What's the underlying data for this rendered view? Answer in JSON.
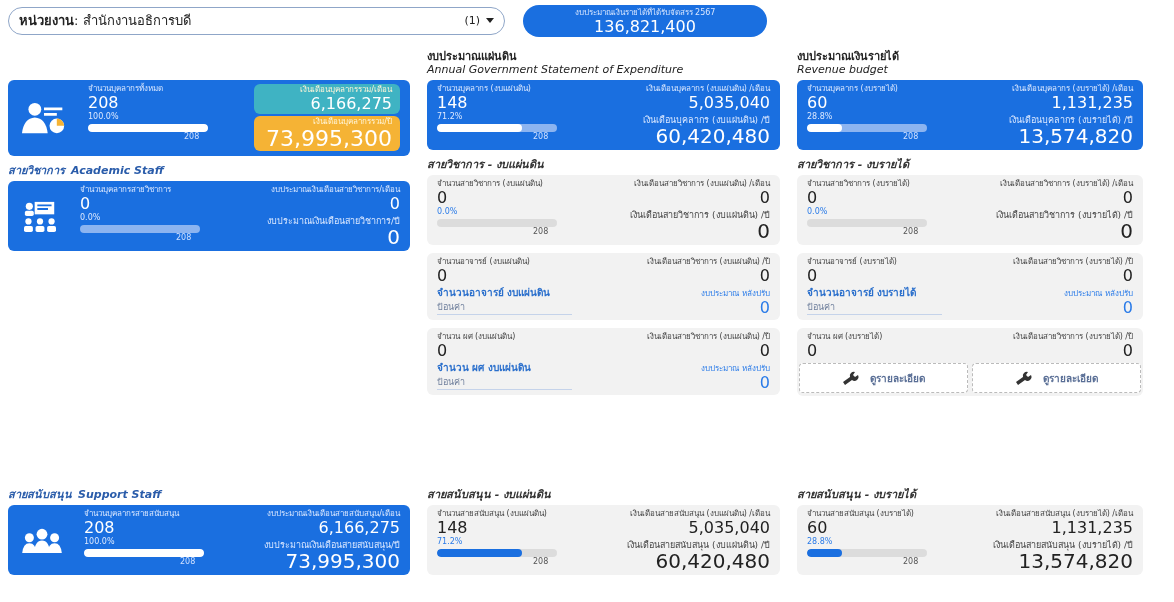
{
  "header": {
    "unit": "**หน่วยงาน**: สำนักงานอธิการบดี",
    "count_badge": "(1)",
    "budget": {
      "label": "งบประมาณเงินรายได้ที่ได้รับจัดสรร 2567",
      "value": "136,821,400"
    }
  },
  "summary": {
    "card": {
      "count_label": "จำนวนบุคลากรทั้งหมด",
      "count": "208",
      "percent": "100.0%",
      "level": 1,
      "scale": "208",
      "amounts": [
        {
          "color": "#3fb3c3",
          "label": "เงินเดือนบุคลากรรวม/เดือน",
          "value": "6,166,275"
        },
        {
          "color": "#f5b335",
          "label": "เงินเดือนบุคลากรรวม/ปี",
          "value": "73,995,300"
        }
      ]
    }
  },
  "budgets": [
    {
      "title": "งบประมาณแผ่นดิน",
      "subtitle": "Annual Government Statement of Expenditure",
      "card": {
        "count_label": "จำนวนบุคลากร (งบแผ่นดิน)",
        "count": "148",
        "percent": "71.2%",
        "level": 0.712,
        "scale": "208",
        "amounts": [
          {
            "label": "เงินเดือนบุคลากร (งบแผ่นดิน) /เดือน",
            "value": "5,035,040"
          },
          {
            "label": "เงินเดือนบุคลากร (งบแผ่นดิน) /ปี",
            "value": "60,420,480"
          }
        ]
      }
    },
    {
      "title": "งบประมาณเงินรายได้",
      "subtitle": "Revenue budget",
      "card": {
        "count_label": "จำนวนบุคลากร (งบรายได้)",
        "count": "60",
        "percent": "28.8%",
        "level": 0.288,
        "scale": "208",
        "amounts": [
          {
            "label": "เงินเดือนบุคลากร (งบรายได้) /เดือน",
            "value": "1,131,235"
          },
          {
            "label": "เงินเดือนบุคลากร (งบรายได้) /ปี",
            "value": "13,574,820"
          }
        ]
      }
    }
  ],
  "academic": {
    "title": "สายวิชาการ",
    "title_en": "Academic Staff",
    "card": {
      "count_label": "จำนวนบุคลากรสายวิชาการ",
      "count": "0",
      "percent": "0.0%",
      "scale": "208",
      "amounts": [
        {
          "label": "งบประมาณเงินเดือนสายวิชาการ/เดือน",
          "value": "0"
        },
        {
          "label": "งบประมาณเงินเดือนสายวิชาการ/ปี",
          "value": "0"
        }
      ]
    }
  },
  "academic_budgets": [
    {
      "title": "สายวิชาการ - งบแผ่นดิน",
      "cards": [
        {
          "count_label": "จำนวนสายวิชาการ (งบแผ่นดิน)",
          "count": "0",
          "percent": "0.0%",
          "scale": "208",
          "amounts": [
            {
              "label": "เงินเดือนสายวิชาการ (งบแผ่นดิน) /เดือน",
              "value": "0"
            },
            {
              "label": "เงินเดือนสายวิชาการ (งบแผ่นดิน) /ปี",
              "value": "0"
            }
          ]
        },
        {
          "count_label": "จำนวนอาจารย์ (งบแผ่นดิน)",
          "count": "0",
          "amounts": [
            {
              "label": "เงินเดือนสายวิชาการ (งบแผ่นดิน) /ปี",
              "value": "0"
            }
          ],
          "input": {
            "label": "จำนวนอาจารย์ งบแผ่นดิน",
            "placeholder": "ป้อนค่า",
            "adjusted_label": "งบประมาณ หลังปรับ",
            "adjusted_value": "0"
          }
        },
        {
          "count_label": "จำนวน ผศ (งบแผ่นดิน)",
          "count": "0",
          "amounts": [
            {
              "label": "เงินเดือนสายวิชาการ (งบแผ่นดิน) /ปี",
              "value": "0"
            }
          ],
          "input": {
            "label": "จำนวน ผศ งบแผ่นดิน",
            "placeholder": "ป้อนค่า",
            "adjusted_label": "งบประมาณ หลังปรับ",
            "adjusted_value": "0"
          }
        }
      ]
    },
    {
      "title": "สายวิชาการ - งบรายได้",
      "cards": [
        {
          "count_label": "จำนวนสายวิชาการ (งบรายได้)",
          "count": "0",
          "percent": "0.0%",
          "scale": "208",
          "amounts": [
            {
              "label": "เงินเดือนสายวิชาการ (งบรายได้) /เดือน",
              "value": "0"
            },
            {
              "label": "เงินเดือนสายวิชาการ (งบรายได้) /ปี",
              "value": "0"
            }
          ]
        },
        {
          "count_label": "จำนวนอาจารย์ (งบรายได้)",
          "count": "0",
          "amounts": [
            {
              "label": "เงินเดือนสายวิชาการ (งบรายได้) /ปี",
              "value": "0"
            }
          ],
          "input": {
            "label": "จำนวนอาจารย์ งบรายได้",
            "placeholder": "ป้อนค่า",
            "adjusted_label": "งบประมาณ หลังปรับ",
            "adjusted_value": "0"
          }
        },
        {
          "count_label": "จำนวน ผศ (งบรายได้)",
          "count": "0",
          "amounts": [
            {
              "label": "เงินเดือนสายวิชาการ (งบรายได้) /ปี",
              "value": "0"
            }
          ],
          "actions": [
            {
              "label": "ดูรายละเอียด"
            },
            {
              "label": "ดูรายละเอียด"
            }
          ]
        }
      ]
    }
  ],
  "support": {
    "title": "สายสนับสนุน",
    "title_en": "Support Staff",
    "card": {
      "count_label": "จำนวนบุคลากรสายสนับสนุน",
      "count": "208",
      "percent": "100.0%",
      "level": 1,
      "scale": "208",
      "amounts": [
        {
          "label": "งบประมาณเงินเดือนสายสนับสนุน/เดือน",
          "value": "6,166,275"
        },
        {
          "label": "งบประมาณเงินเดือนสายสนับสนุน/ปี",
          "value": "73,995,300"
        }
      ]
    }
  },
  "support_budgets": [
    {
      "title": "สายสนับสนุน - งบแผ่นดิน",
      "card": {
        "count_label": "จำนวนสายสนับสนุน (งบแผ่นดิน)",
        "count": "148",
        "percent": "71.2%",
        "level": 0.712,
        "scale": "208",
        "amounts": [
          {
            "label": "เงินเดือนสายสนับสนุน (งบแผ่นดิน) /เดือน",
            "value": "5,035,040"
          },
          {
            "label": "เงินเดือนสายสนับสนุน (งบแผ่นดิน) /ปี",
            "value": "60,420,480"
          }
        ]
      }
    },
    {
      "title": "สายสนับสนุน - งบรายได้",
      "card": {
        "count_label": "จำนวนสายสนับสนุน (งบรายได้)",
        "count": "60",
        "percent": "28.8%",
        "level": 0.288,
        "scale": "208",
        "amounts": [
          {
            "label": "เงินเดือนสายสนับสนุน (งบรายได้) /เดือน",
            "value": "1,131,235"
          },
          {
            "label": "เงินเดือนสายสนับสนุน (งบรายได้) /ปี",
            "value": "13,574,820"
          }
        ]
      }
    }
  ]
}
